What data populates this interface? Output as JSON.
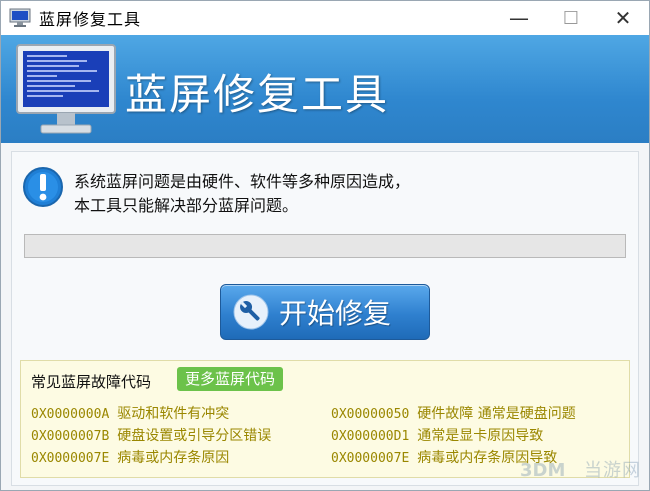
{
  "window": {
    "title": "蓝屏修复工具",
    "controls": {
      "minimize": "—",
      "maximize": "☐",
      "close": "✕"
    }
  },
  "banner": {
    "title": "蓝屏修复工具",
    "icon": "monitor-bluescreen-icon"
  },
  "info": {
    "line1": "系统蓝屏问题是由硬件、软件等多种原因造成，",
    "line2": "本工具只能解决部分蓝屏问题。"
  },
  "progress": {
    "value": 0
  },
  "repair_button": {
    "label": "开始修复",
    "icon": "wrench-icon"
  },
  "codes": {
    "heading": "常见蓝屏故障代码",
    "more_label": "更多蓝屏代码",
    "items": [
      {
        "code": "0X0000000A",
        "desc": "驱动和软件有冲突"
      },
      {
        "code": "0X00000050",
        "desc": "硬件故障 通常是硬盘问题"
      },
      {
        "code": "0X0000007B",
        "desc": "硬盘设置或引导分区错误"
      },
      {
        "code": "0X000000D1",
        "desc": "通常是显卡原因导致"
      },
      {
        "code": "0X0000007E",
        "desc": "病毒或内存条原因"
      },
      {
        "code": "0X0000007E",
        "desc": "病毒或内存条原因导致"
      }
    ]
  },
  "watermark": {
    "text": "当游网"
  },
  "colors": {
    "banner_blue": "#2f87cf",
    "button_blue": "#2f80cf",
    "more_green": "#6cc24a",
    "code_text": "#9a8700",
    "codes_bg": "#fdfbe3"
  }
}
